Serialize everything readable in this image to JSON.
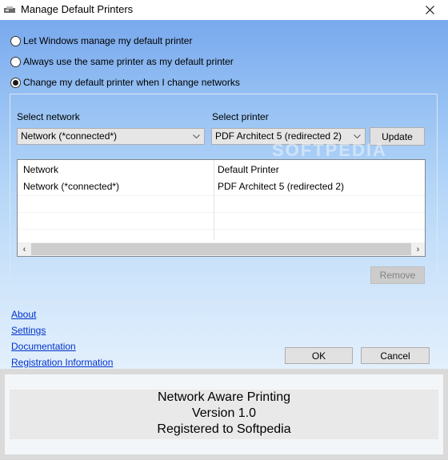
{
  "window": {
    "title": "Manage Default Printers",
    "title_icon": "printer-icon",
    "close_icon": "close-icon"
  },
  "options": [
    {
      "label": "Let Windows manage my default printer",
      "checked": false
    },
    {
      "label": "Always use the same printer as my default printer",
      "checked": false
    },
    {
      "label": "Change my default printer when I change networks",
      "checked": true
    }
  ],
  "network_select": {
    "label": "Select network",
    "value": "Network (*connected*)"
  },
  "printer_select": {
    "label": "Select printer",
    "value": "PDF Architect 5 (redirected 2)"
  },
  "update_button": "Update",
  "table": {
    "columns": [
      "Network",
      "Default Printer"
    ],
    "rows": [
      [
        "Network (*connected*)",
        "PDF Architect 5 (redirected 2)"
      ]
    ]
  },
  "remove_button": "Remove",
  "links": [
    "About",
    "Settings",
    "Documentation",
    "Registration Information"
  ],
  "ok_button": "OK",
  "cancel_button": "Cancel",
  "info": {
    "line1": "Network Aware Printing",
    "line2": "Version 1.0",
    "line3": "Registered to Softpedia"
  },
  "watermark": "SOFTPEDIA",
  "colors": {
    "link": "#0033cc",
    "background_top": "#79a9ee",
    "background_bottom": "#eef5fd"
  }
}
